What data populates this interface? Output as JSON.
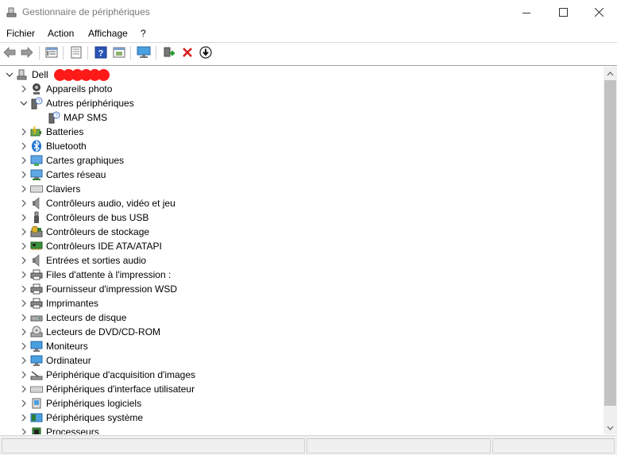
{
  "window": {
    "title": "Gestionnaire de périphériques"
  },
  "menu": [
    {
      "label": "Fichier"
    },
    {
      "label": "Action"
    },
    {
      "label": "Affichage"
    },
    {
      "label": "?"
    }
  ],
  "toolbar": {
    "buttons": [
      "back-arrow-icon",
      "forward-arrow-icon",
      "properties-list-icon",
      "document-icon",
      "help-icon",
      "update-icon",
      "monitor-scan-icon",
      "add-driver-icon",
      "uninstall-x-icon",
      "download-arrow-icon"
    ]
  },
  "tree": {
    "root": {
      "label": "Dell",
      "redacted": true
    },
    "items": [
      {
        "label": "Appareils photo",
        "expanded": false
      },
      {
        "label": "Autres périphériques",
        "expanded": true,
        "children": [
          {
            "label": "MAP SMS"
          }
        ]
      },
      {
        "label": "Batteries",
        "expanded": false
      },
      {
        "label": "Bluetooth",
        "expanded": false
      },
      {
        "label": "Cartes graphiques",
        "expanded": false
      },
      {
        "label": "Cartes réseau",
        "expanded": false
      },
      {
        "label": "Claviers",
        "expanded": false
      },
      {
        "label": "Contrôleurs audio, vidéo et jeu",
        "expanded": false
      },
      {
        "label": "Contrôleurs de bus USB",
        "expanded": false
      },
      {
        "label": "Contrôleurs de stockage",
        "expanded": false
      },
      {
        "label": "Contrôleurs IDE ATA/ATAPI",
        "expanded": false
      },
      {
        "label": "Entrées et sorties audio",
        "expanded": false
      },
      {
        "label": "Files d'attente à l'impression :",
        "expanded": false
      },
      {
        "label": "Fournisseur d'impression WSD",
        "expanded": false
      },
      {
        "label": "Imprimantes",
        "expanded": false
      },
      {
        "label": "Lecteurs de disque",
        "expanded": false
      },
      {
        "label": "Lecteurs de DVD/CD-ROM",
        "expanded": false
      },
      {
        "label": "Moniteurs",
        "expanded": false
      },
      {
        "label": "Ordinateur",
        "expanded": false
      },
      {
        "label": "Périphérique d'acquisition d'images",
        "expanded": false
      },
      {
        "label": "Périphériques d'interface utilisateur",
        "expanded": false
      },
      {
        "label": "Périphériques logiciels",
        "expanded": false
      },
      {
        "label": "Périphériques système",
        "expanded": false
      },
      {
        "label": "Processeurs",
        "expanded": false
      }
    ]
  },
  "colors": {
    "redaction": "#ff1a1a",
    "accent": "#1e73d2",
    "warning": "#f0b400"
  }
}
